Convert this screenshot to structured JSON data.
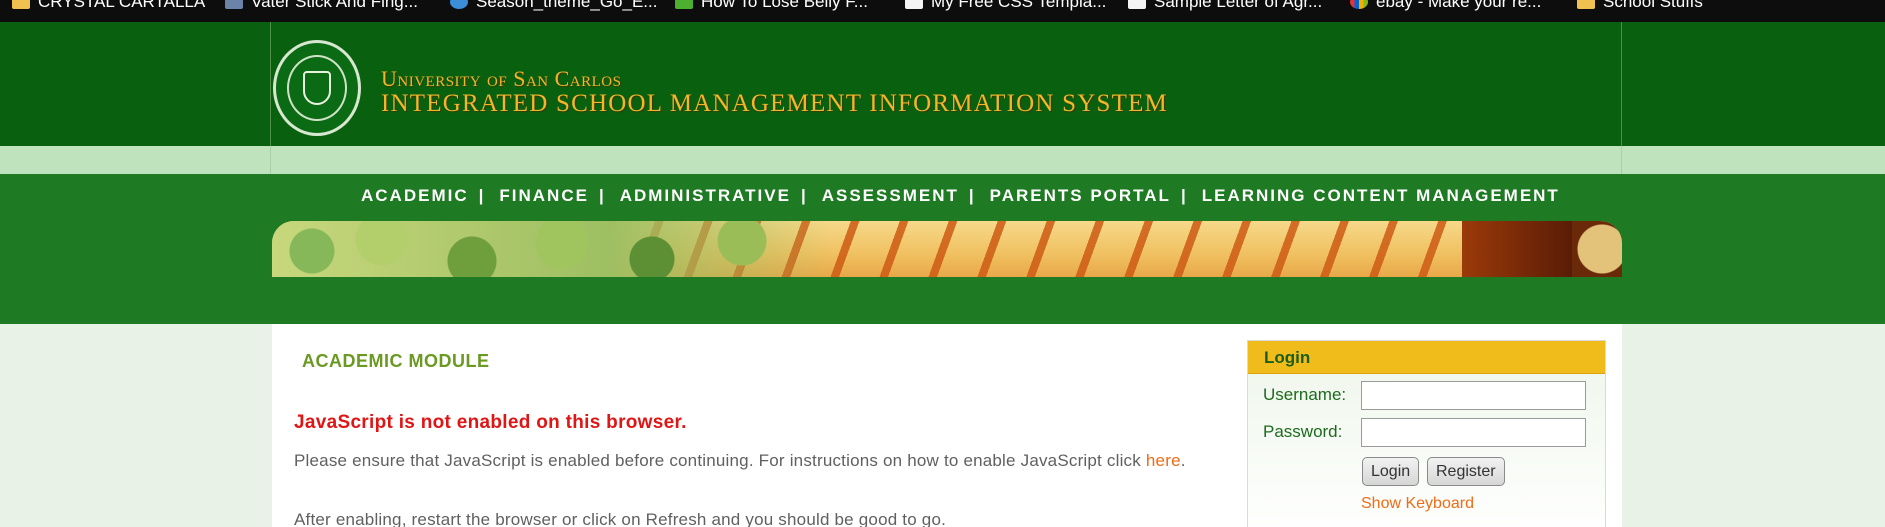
{
  "bookmarks": [
    {
      "label": "CRYSTAL CARTALLA",
      "icon": "folder-icon"
    },
    {
      "label": "Vater Stick And Fing...",
      "icon": "image-icon"
    },
    {
      "label": "Season_theme_Go_E...",
      "icon": "edge-icon"
    },
    {
      "label": "How To Lose Belly F...",
      "icon": "site-icon"
    },
    {
      "label": "My Free CSS Templa...",
      "icon": "page-icon"
    },
    {
      "label": "Sample Letter of Agr...",
      "icon": "page-icon"
    },
    {
      "label": "ebay - Make your re...",
      "icon": "ebay-icon"
    },
    {
      "label": "School Stuffs",
      "icon": "folder-icon"
    }
  ],
  "header": {
    "line1": "University of San Carlos",
    "line2": "INTEGRATED SCHOOL MANAGEMENT INFORMATION SYSTEM"
  },
  "nav": {
    "items": [
      "ACADEMIC",
      "FINANCE",
      "ADMINISTRATIVE",
      "ASSESSMENT",
      "PARENTS PORTAL",
      "LEARNING CONTENT MANAGEMENT"
    ],
    "separator": "|"
  },
  "main": {
    "module_title": "ACADEMIC MODULE",
    "js_title": "JavaScript is not enabled on this browser.",
    "message1": "Please ensure that JavaScript is enabled before continuing. For instructions on how to enable JavaScript click",
    "message1_link": "here",
    "message1_end": ".",
    "message2": "After enabling, restart the browser or click on Refresh and you should be good to go."
  },
  "login": {
    "title": "Login",
    "username_label": "Username:",
    "password_label": "Password:",
    "username_value": "",
    "password_value": "",
    "login_button": "Login",
    "register_button": "Register",
    "keyboard_link": "Show Keyboard"
  },
  "colors": {
    "header_green": "#09610f",
    "nav_green": "#1f7a24",
    "gold": "#f1b62c",
    "error_red": "#e01515",
    "link_orange": "#ef6b14"
  }
}
